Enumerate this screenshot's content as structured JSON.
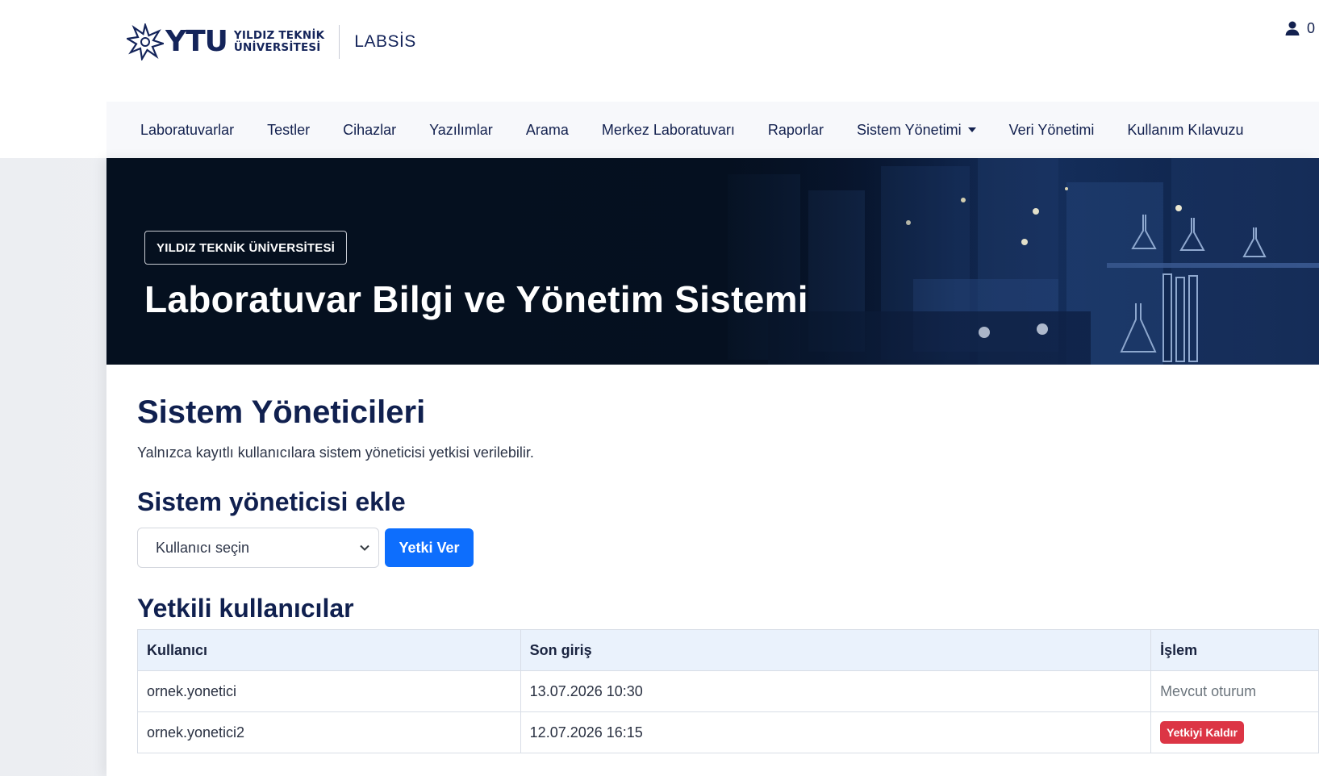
{
  "header": {
    "logo_abbr": "YTU",
    "logo_line1": "YILDIZ TEKNİK",
    "logo_line2": "ÜNİVERSİTESİ",
    "app_name": "LABSİS"
  },
  "nav": {
    "items": [
      {
        "label": "Laboratuvarlar"
      },
      {
        "label": "Testler"
      },
      {
        "label": "Cihazlar"
      },
      {
        "label": "Yazılımlar"
      },
      {
        "label": "Arama"
      },
      {
        "label": "Merkez Laboratuvarı"
      },
      {
        "label": "Raporlar"
      },
      {
        "label": "Sistem Yönetimi"
      },
      {
        "label": "Veri Yönetimi"
      },
      {
        "label": "Kullanım Kılavuzu"
      }
    ],
    "user_label": "0",
    "user_icon": "user-icon",
    "dropdown_icon": "caret-down-icon"
  },
  "hero": {
    "badge": "YILDIZ TEKNİK ÜNİVERSİTESİ",
    "title": "Laboratuvar Bilgi ve Yönetim Sistemi"
  },
  "main": {
    "title": "Sistem Yöneticileri",
    "description": "Yalnızca kayıtlı kullanıcılara sistem yöneticisi yetkisi verilebilir.",
    "add_section_title": "Sistem yöneticisi ekle",
    "select_placeholder": "Kullanıcı seçin",
    "grant_button": "Yetki Ver",
    "list_section_title": "Yetkili kullanıcılar",
    "table": {
      "headers": [
        "Kullanıcı",
        "Son giriş",
        "İşlem"
      ],
      "rows": [
        {
          "user": "ornek.yonetici",
          "last_login": "13.07.2026 10:30",
          "action": "Mevcut oturum"
        },
        {
          "user": "ornek.yonetici2",
          "last_login": "12.07.2026 16:15",
          "action": "Yetkiyi Kaldır"
        }
      ]
    }
  },
  "colors": {
    "primary": "#0d6efd",
    "danger": "#dc3545",
    "navy": "#10204f",
    "table_header_bg": "#eaf2fc"
  }
}
